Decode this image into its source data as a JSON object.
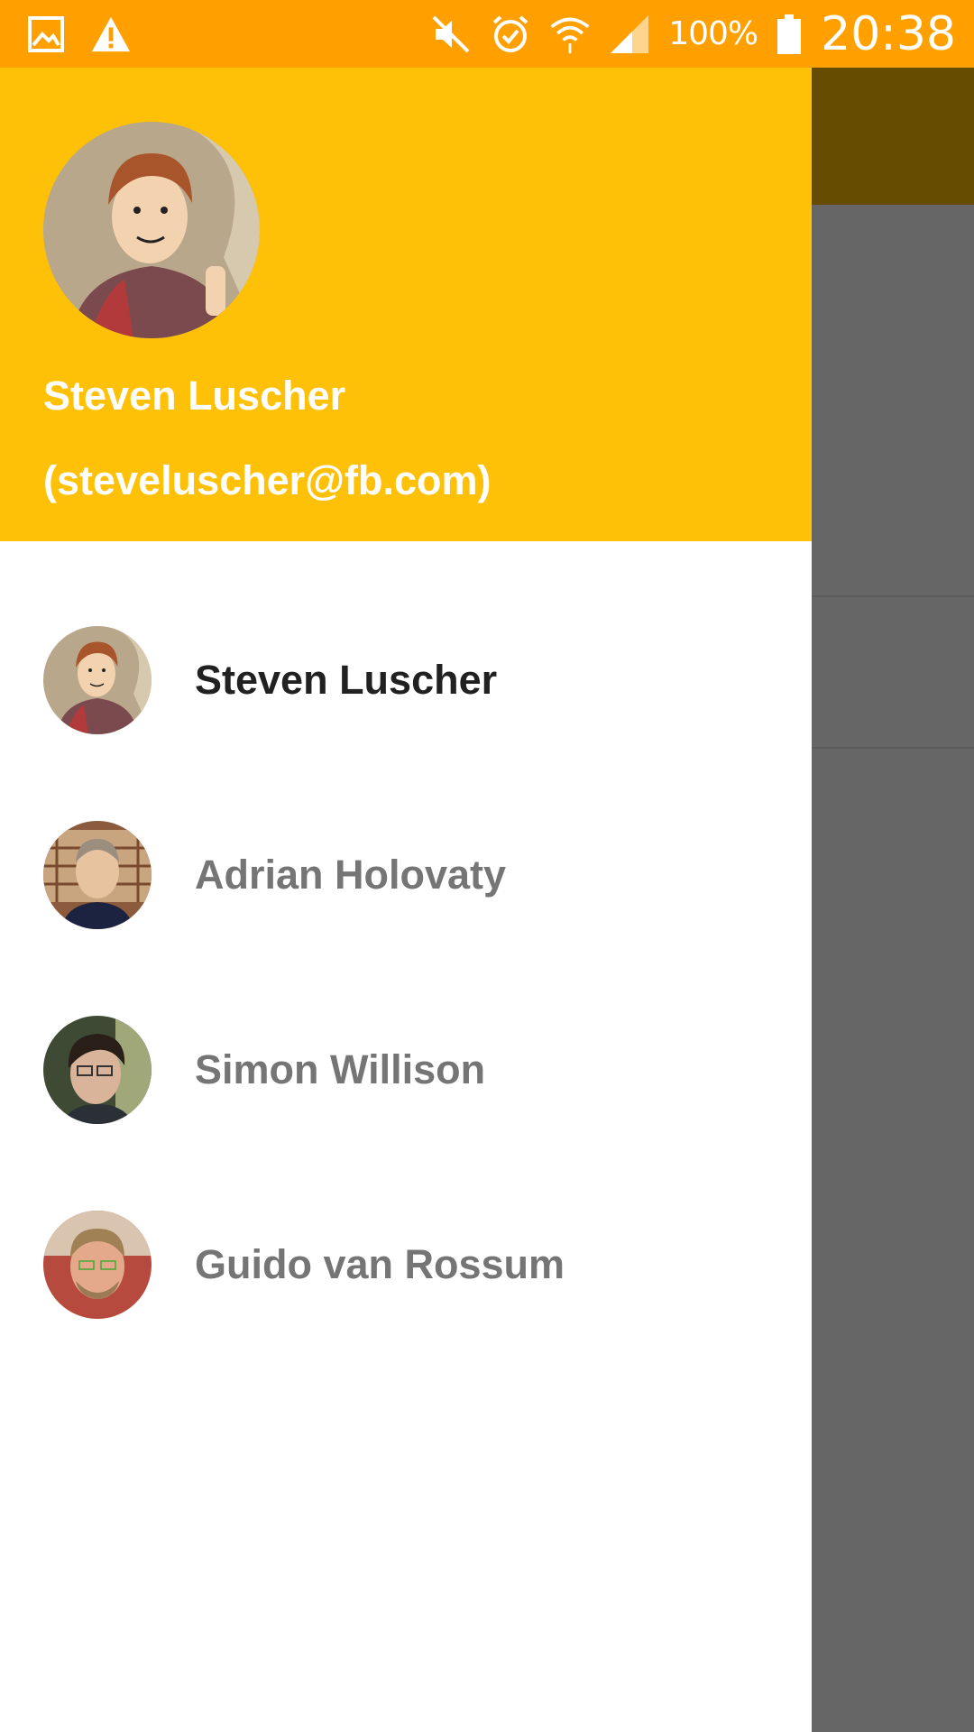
{
  "status_bar": {
    "icons_left": [
      "image-icon",
      "warning-icon"
    ],
    "icons_right": [
      "mute-icon",
      "alarm-icon",
      "wifi-icon",
      "signal-icon",
      "battery-icon"
    ],
    "battery_text": "100%",
    "time": "20:38",
    "color": "#FFA000"
  },
  "drawer": {
    "header_color": "#FFC107",
    "user": {
      "name": "Steven Luscher",
      "email": "(steveluscher@fb.com)"
    },
    "items": [
      {
        "label": "Steven Luscher",
        "active": true
      },
      {
        "label": "Adrian Holovaty",
        "active": false
      },
      {
        "label": "Simon Willison",
        "active": false
      },
      {
        "label": "Guido van Rossum",
        "active": false
      }
    ]
  },
  "scrim_color": "#666666"
}
